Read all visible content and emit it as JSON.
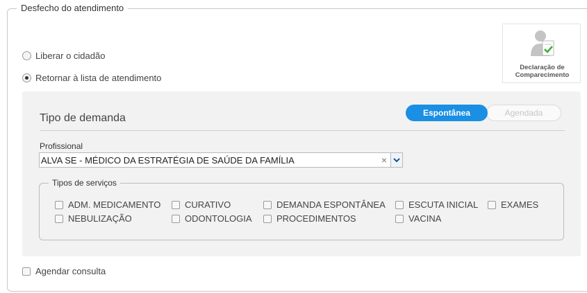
{
  "section": {
    "legend": "Desfecho do atendimento"
  },
  "radios": [
    {
      "label": "Liberar o cidadão",
      "checked": false
    },
    {
      "label": "Retornar à lista de atendimento",
      "checked": true
    }
  ],
  "declaration_card": {
    "line1": "Declaração de",
    "line2": "Comparecimento",
    "icon": "user-document-check-icon"
  },
  "demand": {
    "title": "Tipo de demanda",
    "toggle": {
      "active": "Espontânea",
      "inactive": "Agendada"
    }
  },
  "profissional": {
    "label": "Profissional",
    "value": "ALVA                    SE - MÉDICO DA ESTRATÉGIA DE SAÚDE DA FAMÍLIA",
    "clear_glyph": "×"
  },
  "services": {
    "legend": "Tipos de serviços",
    "items": [
      "ADM. MEDICAMENTO",
      "CURATIVO",
      "DEMANDA ESPONTÂNEA",
      "ESCUTA INICIAL",
      "EXAMES",
      "NEBULIZAÇÃO",
      "ODONTOLOGIA",
      "PROCEDIMENTOS",
      "VACINA"
    ]
  },
  "agendar": {
    "label": "Agendar consulta",
    "checked": false
  },
  "colors": {
    "accent": "#1a8fe3",
    "panel_bg": "#f2f2f2",
    "border": "#c7c7c7"
  }
}
